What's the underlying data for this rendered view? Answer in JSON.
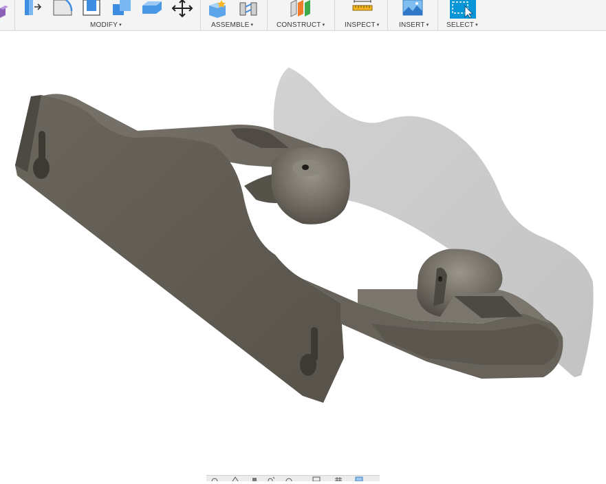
{
  "toolbar": {
    "groups": [
      {
        "label": "MODIFY",
        "caret": "▾"
      },
      {
        "label": "ASSEMBLE",
        "caret": "▾"
      },
      {
        "label": "CONSTRUCT",
        "caret": "▾"
      },
      {
        "label": "INSPECT",
        "caret": "▾"
      },
      {
        "label": "INSERT",
        "caret": "▾"
      },
      {
        "label": "SELECT",
        "caret": "▾"
      }
    ],
    "modify_icons": [
      "press-pull-icon",
      "fillet-icon",
      "shell-icon",
      "combine-icon",
      "offset-face-icon",
      "move-icon"
    ],
    "assemble_icons": [
      "new-component-icon",
      "joint-icon"
    ],
    "construct_icons": [
      "offset-plane-icon"
    ],
    "inspect_icons": [
      "measure-icon"
    ],
    "insert_icons": [
      "insert-image-icon"
    ],
    "select_icons": [
      "select-icon"
    ]
  },
  "viewport": {
    "model": "bracket-3d-model",
    "model_color": "#5f5b52",
    "shadow_color": "#c9c9c9"
  },
  "nav_bar": {
    "icons": [
      "orbit-icon",
      "look-at-icon",
      "pan-icon",
      "zoom-icon",
      "fit-icon",
      "display-settings-icon",
      "grid-settings-icon",
      "viewports-icon"
    ]
  }
}
